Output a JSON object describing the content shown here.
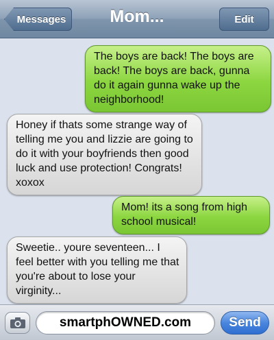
{
  "header": {
    "back_label": "Messages",
    "title": "Mom...",
    "edit_label": "Edit"
  },
  "messages": [
    {
      "side": "sent",
      "text": "The boys are back! The boys are back! The boys are back, gunna do it again gunna wake up the neighborhood!"
    },
    {
      "side": "received",
      "text": "Honey if thats some strange way of telling me you and lizzie are going to do it with your boyfriends then good luck and use protection! Congrats! xoxox"
    },
    {
      "side": "sent",
      "text": "Mom! its a song from high school musical!"
    },
    {
      "side": "received",
      "text": "Sweetie.. youre seventeen... I feel better with you telling me that you're about to lose your virginity..."
    }
  ],
  "composer": {
    "input_value": "smartphOWNED.com",
    "send_label": "Send",
    "camera_icon": "camera-icon"
  },
  "colors": {
    "sent_bubble": "#8cd640",
    "received_bubble": "#e2e2e2",
    "send_button": "#4a86de",
    "background": "#dbe2ed"
  }
}
